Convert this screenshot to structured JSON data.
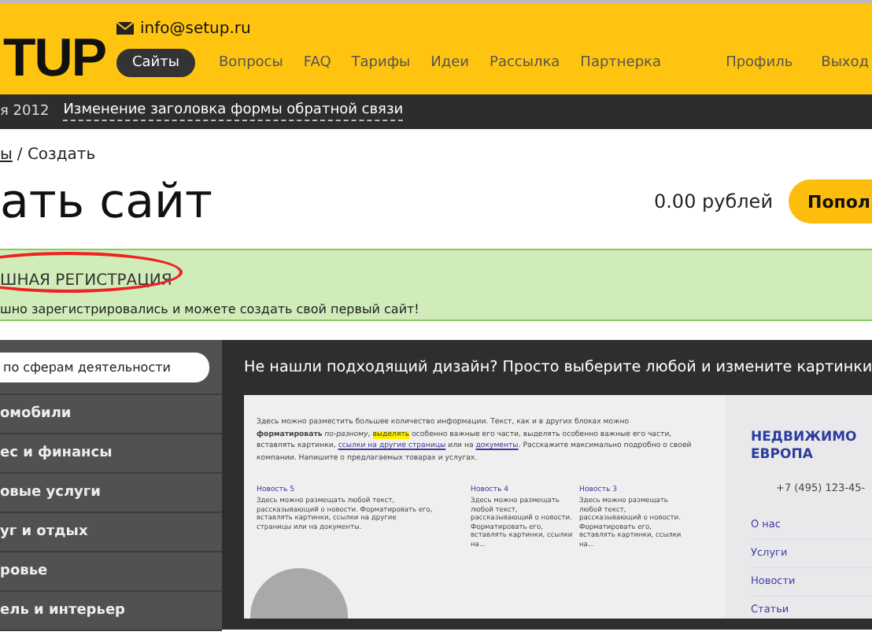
{
  "header": {
    "email": "info@setup.ru",
    "logo": "TUP",
    "nav": [
      {
        "label": "Сайты",
        "selected": true
      },
      {
        "label": "Вопросы",
        "selected": false
      },
      {
        "label": "FAQ",
        "selected": false
      },
      {
        "label": "Тарифы",
        "selected": false
      },
      {
        "label": "Идеи",
        "selected": false
      },
      {
        "label": "Рассылка",
        "selected": false
      },
      {
        "label": "Партнерка",
        "selected": false
      }
    ],
    "account": [
      "Профиль",
      "Выход"
    ]
  },
  "news_bar": {
    "date": "я 2012",
    "link": "Изменение заголовка формы обратной связи"
  },
  "breadcrumb": {
    "link": "ы",
    "current": "/ Создать"
  },
  "page_title": "ать сайт",
  "balance": "0.00 рублей",
  "topup_button": "Попол",
  "notice": {
    "title": "ШНАЯ РЕГИСТРАЦИЯ",
    "text": "шно зарегистрировались и можете создать свой первый сайт!",
    "circled": true
  },
  "sidebar": {
    "search_placeholder": "по сферам деятельности",
    "items": [
      "омобили",
      "ес и финансы",
      "овые услуги",
      "уг и отдых",
      "ровье",
      "ель и интерьер"
    ]
  },
  "designs": {
    "heading": "Не нашли подходящий дизайн? Просто выберите любой и измените картинки",
    "preview": {
      "intro": [
        {
          "kind": "plain",
          "text": "Здесь можно разместить большее количество информации. Текст, как и в других блоках можно "
        },
        {
          "kind": "bold",
          "text": "форматировать"
        },
        {
          "kind": "italic",
          "text": "по-разному"
        },
        {
          "kind": "plain",
          "text": ", "
        },
        {
          "kind": "highlight",
          "text": "выделять"
        },
        {
          "kind": "plain",
          "text": " особенно важные его части, выделять особенно важные его части, вставлять картинки, "
        },
        {
          "kind": "link",
          "text": "ссылки на другие страницы"
        },
        {
          "kind": "plain",
          "text": " или на "
        },
        {
          "kind": "link",
          "text": "документы"
        },
        {
          "kind": "plain",
          "text": ". Расскажите максимально подробно о своей компании. Напишите о предлагаемых товарах и услугах."
        }
      ],
      "news": [
        {
          "title": "Новость 5",
          "text": "Здесь можно размещать любой текст, рассказывающий о новости. Форматировать его, вставлять картинки, ссылки на другие страницы или на документы."
        },
        {
          "title": "Новость 4",
          "text": "Здесь можно размещать любой текст, рассказывающий о новости. Форматировать его, вставлять картинки, ссылки на..."
        },
        {
          "title": "Новость 3",
          "text": "Здесь можно размещать любой текст, рассказывающий о новости. Форматировать его, вставлять картинки, ссылки на..."
        }
      ],
      "company": "НЕДВИЖИМО ЕВРОПА",
      "phone": "+7 (495) 123-45-",
      "menu": [
        "О нас",
        "Услуги",
        "Новости",
        "Статьи"
      ]
    }
  }
}
